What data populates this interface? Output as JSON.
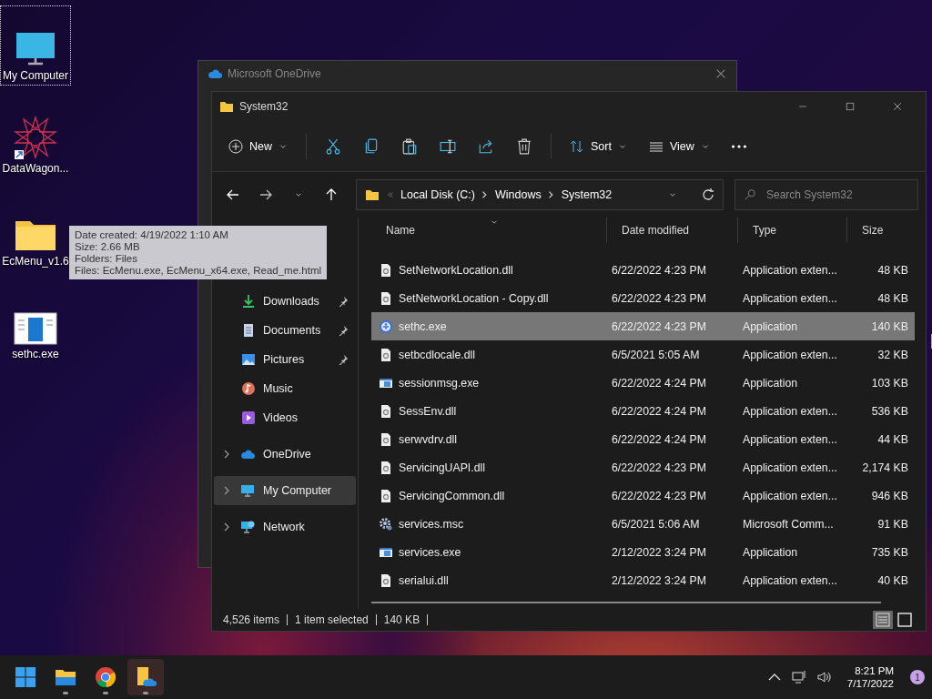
{
  "desktop_icons": [
    {
      "label": "My Computer",
      "kind": "computer",
      "selected": true
    },
    {
      "label": "DataWagon...",
      "kind": "star",
      "selected": false
    },
    {
      "label": "EcMenu_v1.6",
      "kind": "folder",
      "selected": false
    },
    {
      "label": "sethc.exe",
      "kind": "app",
      "selected": false
    }
  ],
  "tooltip": [
    "Date created: 4/19/2022 1:10 AM",
    "Size: 2.66 MB",
    "Folders: Files",
    "Files: EcMenu.exe, EcMenu_x64.exe, Read_me.html"
  ],
  "back_window": {
    "title": "Microsoft OneDrive"
  },
  "window": {
    "title": "System32"
  },
  "toolbar": {
    "new": "New",
    "sort": "Sort",
    "view": "View"
  },
  "address": {
    "crumbs": [
      "Local Disk (C:)",
      "Windows",
      "System32"
    ]
  },
  "search": {
    "placeholder": "Search System32"
  },
  "sidebar": {
    "items": [
      {
        "label": "Downloads",
        "kind": "download",
        "pinned": true,
        "selected": false,
        "expandable": false
      },
      {
        "label": "Documents",
        "kind": "document",
        "pinned": true,
        "selected": false,
        "expandable": false
      },
      {
        "label": "Pictures",
        "kind": "picture",
        "pinned": true,
        "selected": false,
        "expandable": false
      },
      {
        "label": "Music",
        "kind": "music",
        "pinned": false,
        "selected": false,
        "expandable": false
      },
      {
        "label": "Videos",
        "kind": "video",
        "pinned": false,
        "selected": false,
        "expandable": false
      },
      {
        "label": "OneDrive",
        "kind": "cloud",
        "pinned": false,
        "selected": false,
        "expandable": true
      },
      {
        "label": "My Computer",
        "kind": "computer",
        "pinned": false,
        "selected": true,
        "expandable": true
      },
      {
        "label": "Network",
        "kind": "network",
        "pinned": false,
        "selected": false,
        "expandable": true
      }
    ]
  },
  "table": {
    "columns": [
      "Name",
      "Date modified",
      "Type",
      "Size"
    ],
    "rows": [
      {
        "name": "SetNetworkLocation.dll",
        "date": "6/22/2022 4:23 PM",
        "type": "Application exten...",
        "size": "48 KB",
        "kind": "dll",
        "selected": false
      },
      {
        "name": "SetNetworkLocation - Copy.dll",
        "date": "6/22/2022 4:23 PM",
        "type": "Application exten...",
        "size": "48 KB",
        "kind": "dll",
        "selected": false
      },
      {
        "name": "sethc.exe",
        "date": "6/22/2022 4:23 PM",
        "type": "Application",
        "size": "140 KB",
        "kind": "app",
        "selected": true
      },
      {
        "name": "setbcdlocale.dll",
        "date": "6/5/2021 5:05 AM",
        "type": "Application exten...",
        "size": "32 KB",
        "kind": "dll",
        "selected": false
      },
      {
        "name": "sessionmsg.exe",
        "date": "6/22/2022 4:24 PM",
        "type": "Application",
        "size": "103 KB",
        "kind": "exe",
        "selected": false
      },
      {
        "name": "SessEnv.dll",
        "date": "6/22/2022 4:24 PM",
        "type": "Application exten...",
        "size": "536 KB",
        "kind": "dll",
        "selected": false
      },
      {
        "name": "serwvdrv.dll",
        "date": "6/22/2022 4:24 PM",
        "type": "Application exten...",
        "size": "44 KB",
        "kind": "dll",
        "selected": false
      },
      {
        "name": "ServicingUAPI.dll",
        "date": "6/22/2022 4:23 PM",
        "type": "Application exten...",
        "size": "2,174 KB",
        "kind": "dll",
        "selected": false
      },
      {
        "name": "ServicingCommon.dll",
        "date": "6/22/2022 4:23 PM",
        "type": "Application exten...",
        "size": "946 KB",
        "kind": "dll",
        "selected": false
      },
      {
        "name": "services.msc",
        "date": "6/5/2021 5:06 AM",
        "type": "Microsoft Comm...",
        "size": "91 KB",
        "kind": "msc",
        "selected": false
      },
      {
        "name": "services.exe",
        "date": "2/12/2022 3:24 PM",
        "type": "Application",
        "size": "735 KB",
        "kind": "exe",
        "selected": false
      },
      {
        "name": "serialui.dll",
        "date": "2/12/2022 3:24 PM",
        "type": "Application exten...",
        "size": "40 KB",
        "kind": "dll",
        "selected": false
      }
    ]
  },
  "status_bar": {
    "items": "4,526 items",
    "selection": "1 item selected",
    "size": "140 KB"
  },
  "view_buttons": [
    {
      "kind": "details",
      "selected": true
    },
    {
      "kind": "tiles",
      "selected": false
    }
  ],
  "taskbar": {
    "apps": [
      {
        "kind": "start",
        "running": false,
        "active": false
      },
      {
        "kind": "explorer",
        "running": true,
        "active": false
      },
      {
        "kind": "chrome",
        "running": true,
        "active": false
      },
      {
        "kind": "onedrive-folder",
        "running": true,
        "active": true
      }
    ],
    "time": "8:21 PM",
    "date": "7/17/2022",
    "notification_count": "1"
  }
}
